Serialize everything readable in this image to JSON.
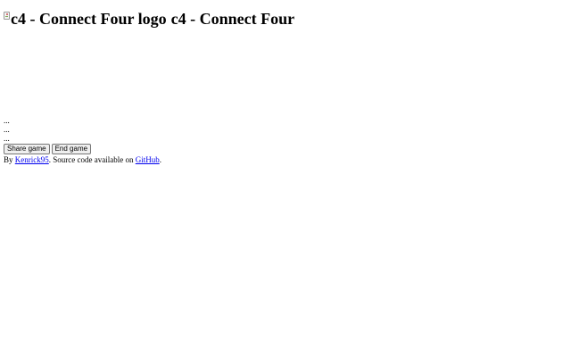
{
  "header": {
    "logo_alt": "c4 - Connect Four logo",
    "title": "c4 - Connect Four"
  },
  "status": {
    "line1": "...",
    "line2": "...",
    "line3": "..."
  },
  "buttons": {
    "share_label": "Share game",
    "end_label": "End game"
  },
  "footer": {
    "prefix": "By ",
    "author_link": "Kenrick95",
    "middle": ". Source code available on ",
    "github_link": "GitHub",
    "suffix": "."
  },
  "colors": {
    "link": "#0000ee",
    "text": "#000000",
    "background": "#ffffff"
  }
}
